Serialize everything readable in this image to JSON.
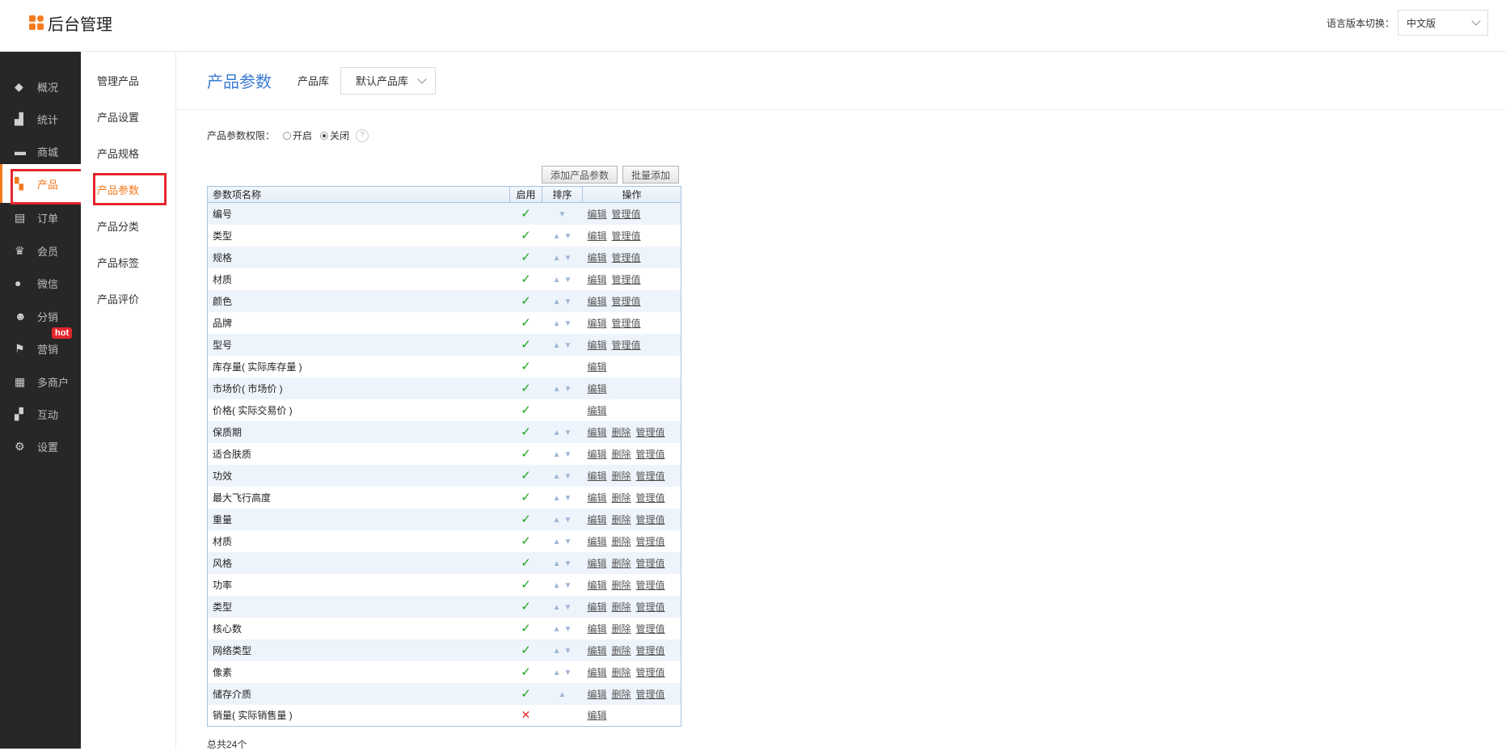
{
  "header": {
    "title": "后台管理",
    "lang_label": "语言版本切换：",
    "lang_value": "中文版"
  },
  "sidebar": [
    {
      "label": "概况",
      "icon": "layers-icon"
    },
    {
      "label": "统计",
      "icon": "chart-icon"
    },
    {
      "label": "商城",
      "icon": "mail-icon"
    },
    {
      "label": "产品",
      "icon": "grid-icon"
    },
    {
      "label": "订单",
      "icon": "clipboard-icon"
    },
    {
      "label": "会员",
      "icon": "crown-icon"
    },
    {
      "label": "微信",
      "icon": "wechat-icon"
    },
    {
      "label": "分销",
      "icon": "users-icon"
    },
    {
      "label": "营销",
      "icon": "flag-icon"
    },
    {
      "label": "多商户",
      "icon": "store-icon"
    },
    {
      "label": "互动",
      "icon": "blocks-icon"
    },
    {
      "label": "设置",
      "icon": "gear-icon"
    }
  ],
  "hot_badge": "hot",
  "subnav": [
    "管理产品",
    "产品设置",
    "产品规格",
    "产品参数",
    "产品分类",
    "产品标签",
    "产品评价"
  ],
  "page": {
    "title": "产品参数",
    "lib_label": "产品库",
    "lib_value": "默认产品库"
  },
  "permission": {
    "label": "产品参数权限：",
    "on": "开启",
    "off": "关闭",
    "help": "?"
  },
  "buttons": {
    "add": "添加产品参数",
    "batch": "批量添加"
  },
  "table": {
    "headers": [
      "参数项名称",
      "启用",
      "排序",
      "操作"
    ],
    "links": {
      "edit": "编辑",
      "delete": "删除",
      "manage": "管理值"
    },
    "rows": [
      {
        "name": "编号",
        "enabled": true,
        "sort": "down",
        "ops": [
          "edit",
          "manage"
        ]
      },
      {
        "name": "类型",
        "enabled": true,
        "sort": "both",
        "ops": [
          "edit",
          "manage"
        ]
      },
      {
        "name": "规格",
        "enabled": true,
        "sort": "both",
        "ops": [
          "edit",
          "manage"
        ]
      },
      {
        "name": "材质",
        "enabled": true,
        "sort": "both",
        "ops": [
          "edit",
          "manage"
        ]
      },
      {
        "name": "颜色",
        "enabled": true,
        "sort": "both",
        "ops": [
          "edit",
          "manage"
        ]
      },
      {
        "name": "品牌",
        "enabled": true,
        "sort": "both",
        "ops": [
          "edit",
          "manage"
        ]
      },
      {
        "name": "型号",
        "enabled": true,
        "sort": "both",
        "ops": [
          "edit",
          "manage"
        ]
      },
      {
        "name": "库存量( 实际库存量 )",
        "enabled": true,
        "sort": "none",
        "ops": [
          "edit"
        ]
      },
      {
        "name": "市场价( 市场价 )",
        "enabled": true,
        "sort": "both",
        "ops": [
          "edit"
        ]
      },
      {
        "name": "价格( 实际交易价 )",
        "enabled": true,
        "sort": "none",
        "ops": [
          "edit"
        ]
      },
      {
        "name": "保质期",
        "enabled": true,
        "sort": "both",
        "ops": [
          "edit",
          "delete",
          "manage"
        ]
      },
      {
        "name": "适合肤质",
        "enabled": true,
        "sort": "both",
        "ops": [
          "edit",
          "delete",
          "manage"
        ]
      },
      {
        "name": "功效",
        "enabled": true,
        "sort": "both",
        "ops": [
          "edit",
          "delete",
          "manage"
        ]
      },
      {
        "name": "最大飞行高度",
        "enabled": true,
        "sort": "both",
        "ops": [
          "edit",
          "delete",
          "manage"
        ]
      },
      {
        "name": "重量",
        "enabled": true,
        "sort": "both",
        "ops": [
          "edit",
          "delete",
          "manage"
        ]
      },
      {
        "name": "材质",
        "enabled": true,
        "sort": "both",
        "ops": [
          "edit",
          "delete",
          "manage"
        ]
      },
      {
        "name": "风格",
        "enabled": true,
        "sort": "both",
        "ops": [
          "edit",
          "delete",
          "manage"
        ]
      },
      {
        "name": "功率",
        "enabled": true,
        "sort": "both",
        "ops": [
          "edit",
          "delete",
          "manage"
        ]
      },
      {
        "name": "类型",
        "enabled": true,
        "sort": "both",
        "ops": [
          "edit",
          "delete",
          "manage"
        ]
      },
      {
        "name": "核心数",
        "enabled": true,
        "sort": "both",
        "ops": [
          "edit",
          "delete",
          "manage"
        ]
      },
      {
        "name": "网络类型",
        "enabled": true,
        "sort": "both",
        "ops": [
          "edit",
          "delete",
          "manage"
        ]
      },
      {
        "name": "像素",
        "enabled": true,
        "sort": "both",
        "ops": [
          "edit",
          "delete",
          "manage"
        ]
      },
      {
        "name": "储存介质",
        "enabled": true,
        "sort": "up",
        "ops": [
          "edit",
          "delete",
          "manage"
        ]
      },
      {
        "name": "销量( 实际销售量 )",
        "enabled": false,
        "sort": "none",
        "ops": [
          "edit"
        ]
      }
    ]
  },
  "total": "总共24个",
  "colors": {
    "accent": "#f47b20",
    "title_blue": "#3a7bd5",
    "highlight_red": "#e5262d",
    "sidebar_bg": "#272727"
  }
}
